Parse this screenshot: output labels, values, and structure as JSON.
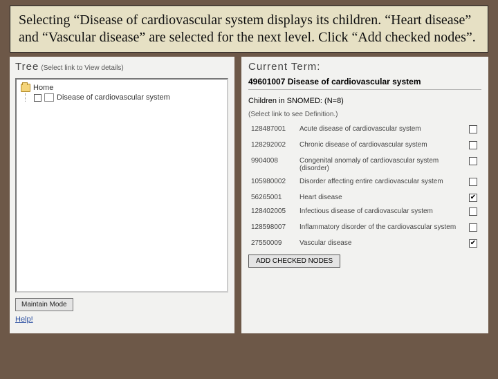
{
  "callout": "Selecting “Disease of cardiovascular system displays its children.  “Heart disease” and “Vascular disease” are selected for the next level.  Click “Add checked nodes”.",
  "left": {
    "title": "Tree",
    "subtitle": "(Select link to View details)",
    "root_label": "Home",
    "child_label": "Disease of cardiovascular system",
    "maintain_button": "Maintain Mode",
    "help": "Help!"
  },
  "right": {
    "title": "Current Term:",
    "term": "49601007 Disease of cardiovascular system",
    "children_header": "Children in SNOMED: (N=8)",
    "hint": "(Select link to see Definition.)",
    "add_button": "ADD CHECKED NODES",
    "children": [
      {
        "code": "128487001",
        "name": "Acute disease of cardiovascular system",
        "checked": false
      },
      {
        "code": "128292002",
        "name": "Chronic disease of cardiovascular system",
        "checked": false
      },
      {
        "code": "9904008",
        "name": "Congenital anomaly of cardiovascular system (disorder)",
        "checked": false
      },
      {
        "code": "105980002",
        "name": "Disorder affecting entire cardiovascular system",
        "checked": false
      },
      {
        "code": "56265001",
        "name": "Heart disease",
        "checked": true
      },
      {
        "code": "128402005",
        "name": "Infectious disease of cardiovascular system",
        "checked": false
      },
      {
        "code": "128598007",
        "name": "Inflammatory disorder of the cardiovascular system",
        "checked": false
      },
      {
        "code": "27550009",
        "name": "Vascular disease",
        "checked": true
      }
    ]
  }
}
